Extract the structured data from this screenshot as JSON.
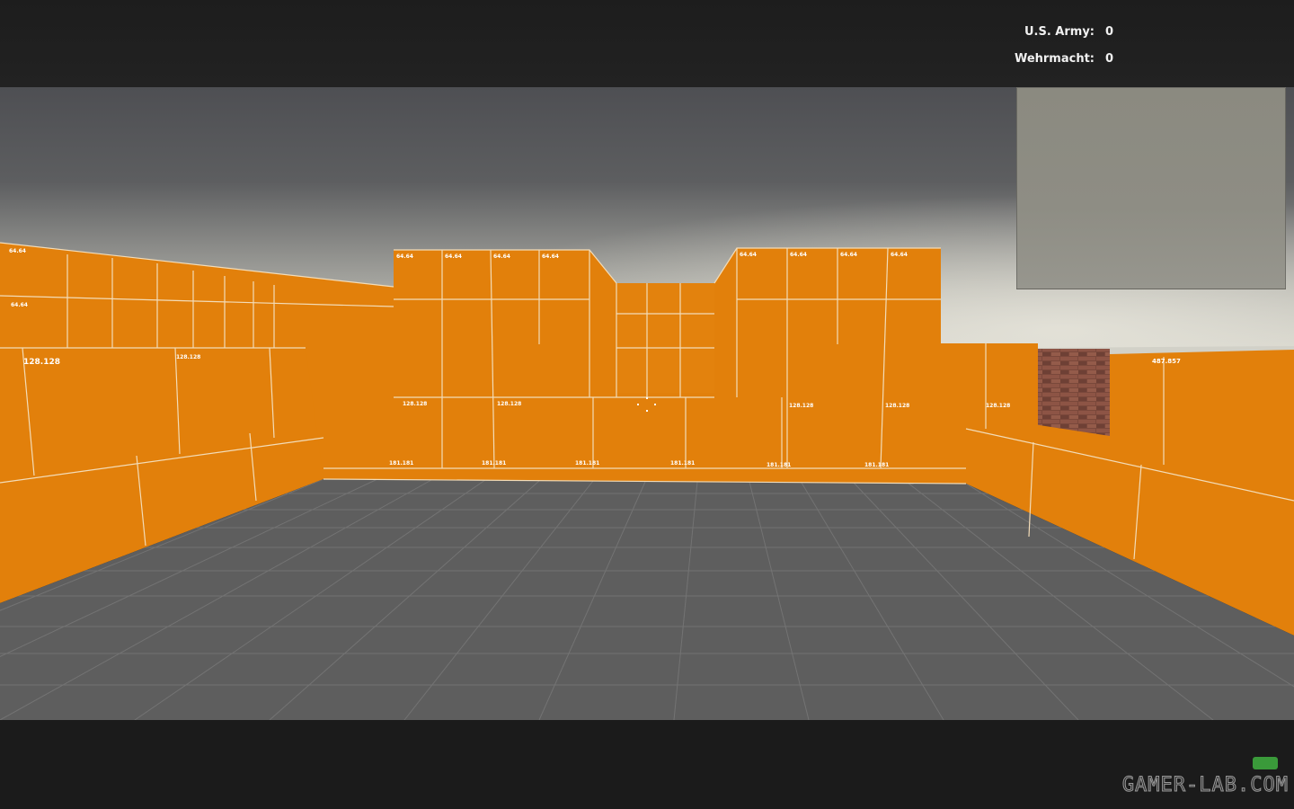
{
  "scoreboard": {
    "teams": [
      {
        "name": "U.S. Army:",
        "score": "0"
      },
      {
        "name": "Wehrmacht:",
        "score": "0"
      }
    ]
  },
  "dev_texture_labels": {
    "small": "64.64",
    "medium": "128.128",
    "bottom": "181.181",
    "right": "487.857"
  },
  "colors": {
    "wall": "#e2800b",
    "wall_line": "#f6e2c4",
    "floor": "#5f5f5f",
    "floor_grid": "#7e7e7e",
    "sky_dark": "#4f5054",
    "sky_light": "#c8c7bd",
    "brick": "#7d4b3e"
  },
  "watermark": "GAMER-LAB.COM"
}
